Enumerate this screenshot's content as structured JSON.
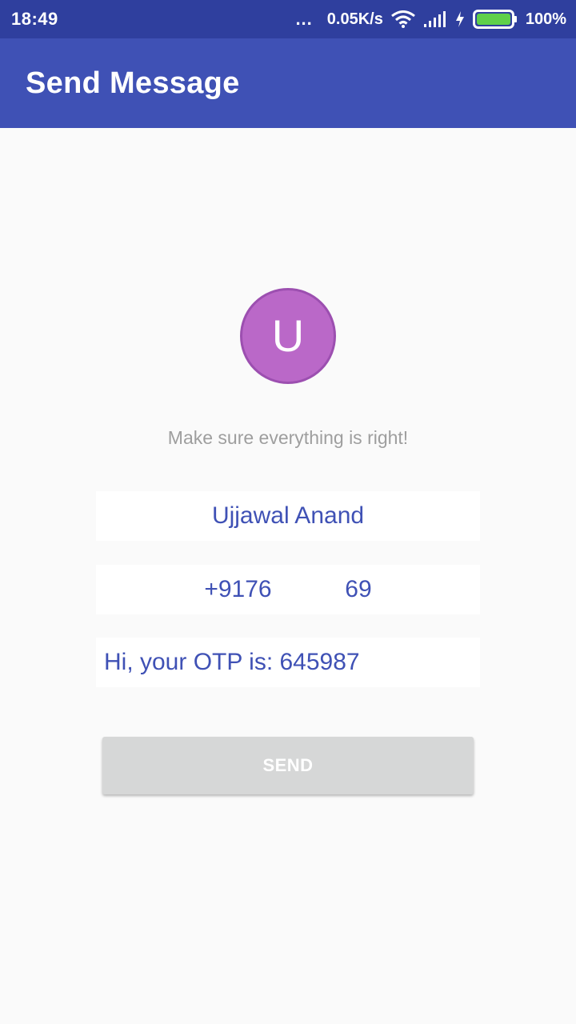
{
  "status_bar": {
    "time": "18:49",
    "more": "...",
    "network_speed": "0.05K/s",
    "battery": "100%",
    "icons": [
      "wifi-icon",
      "signal-icon",
      "charging-icon",
      "battery-icon"
    ]
  },
  "app_bar": {
    "title": "Send Message"
  },
  "contact": {
    "avatar_letter": "U",
    "avatar_color": "#ba68c8",
    "hint": "Make sure everything is right!",
    "name": "Ujjawal Anand",
    "phone": "+9176           69",
    "message": "Hi, your OTP is: 645987"
  },
  "actions": {
    "send_label": "SEND"
  },
  "colors": {
    "primary": "#3f51b5",
    "primary_dark": "#2f3f9e",
    "button_disabled": "#d6d7d7"
  }
}
